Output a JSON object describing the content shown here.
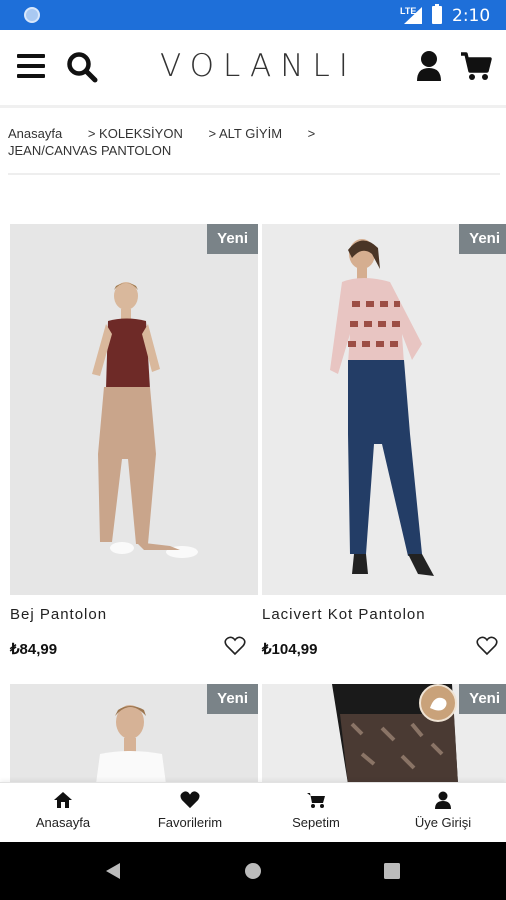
{
  "status_bar": {
    "network": "LTE",
    "time": "2:10"
  },
  "header": {
    "logo": "VOLANLI",
    "icons": [
      "menu-icon",
      "search-icon",
      "user-icon",
      "cart-icon"
    ]
  },
  "breadcrumb": {
    "items": [
      "Anasayfa",
      "> KOLEKSİYON",
      "> ALT GİYİM",
      ">"
    ],
    "current": "JEAN/CANVAS PANTOLON"
  },
  "products": [
    {
      "name": "Bej Pantolon",
      "price": "₺84,99",
      "badge": "Yeni"
    },
    {
      "name": "Lacivert Kot Pantolon",
      "price": "₺104,99",
      "badge": "Yeni"
    },
    {
      "name": "",
      "price": "",
      "badge": "Yeni"
    },
    {
      "name": "",
      "price": "",
      "badge": "Yeni"
    }
  ],
  "bottom_nav": [
    {
      "label": "Anasayfa",
      "icon": "home-icon"
    },
    {
      "label": "Favorilerim",
      "icon": "heart-icon"
    },
    {
      "label": "Sepetim",
      "icon": "cart-icon"
    },
    {
      "label": "Üye Girişi",
      "icon": "user-icon"
    }
  ],
  "colors": {
    "status_bar": "#1e6fd9",
    "badge": "#7a8388",
    "text": "#222222"
  }
}
